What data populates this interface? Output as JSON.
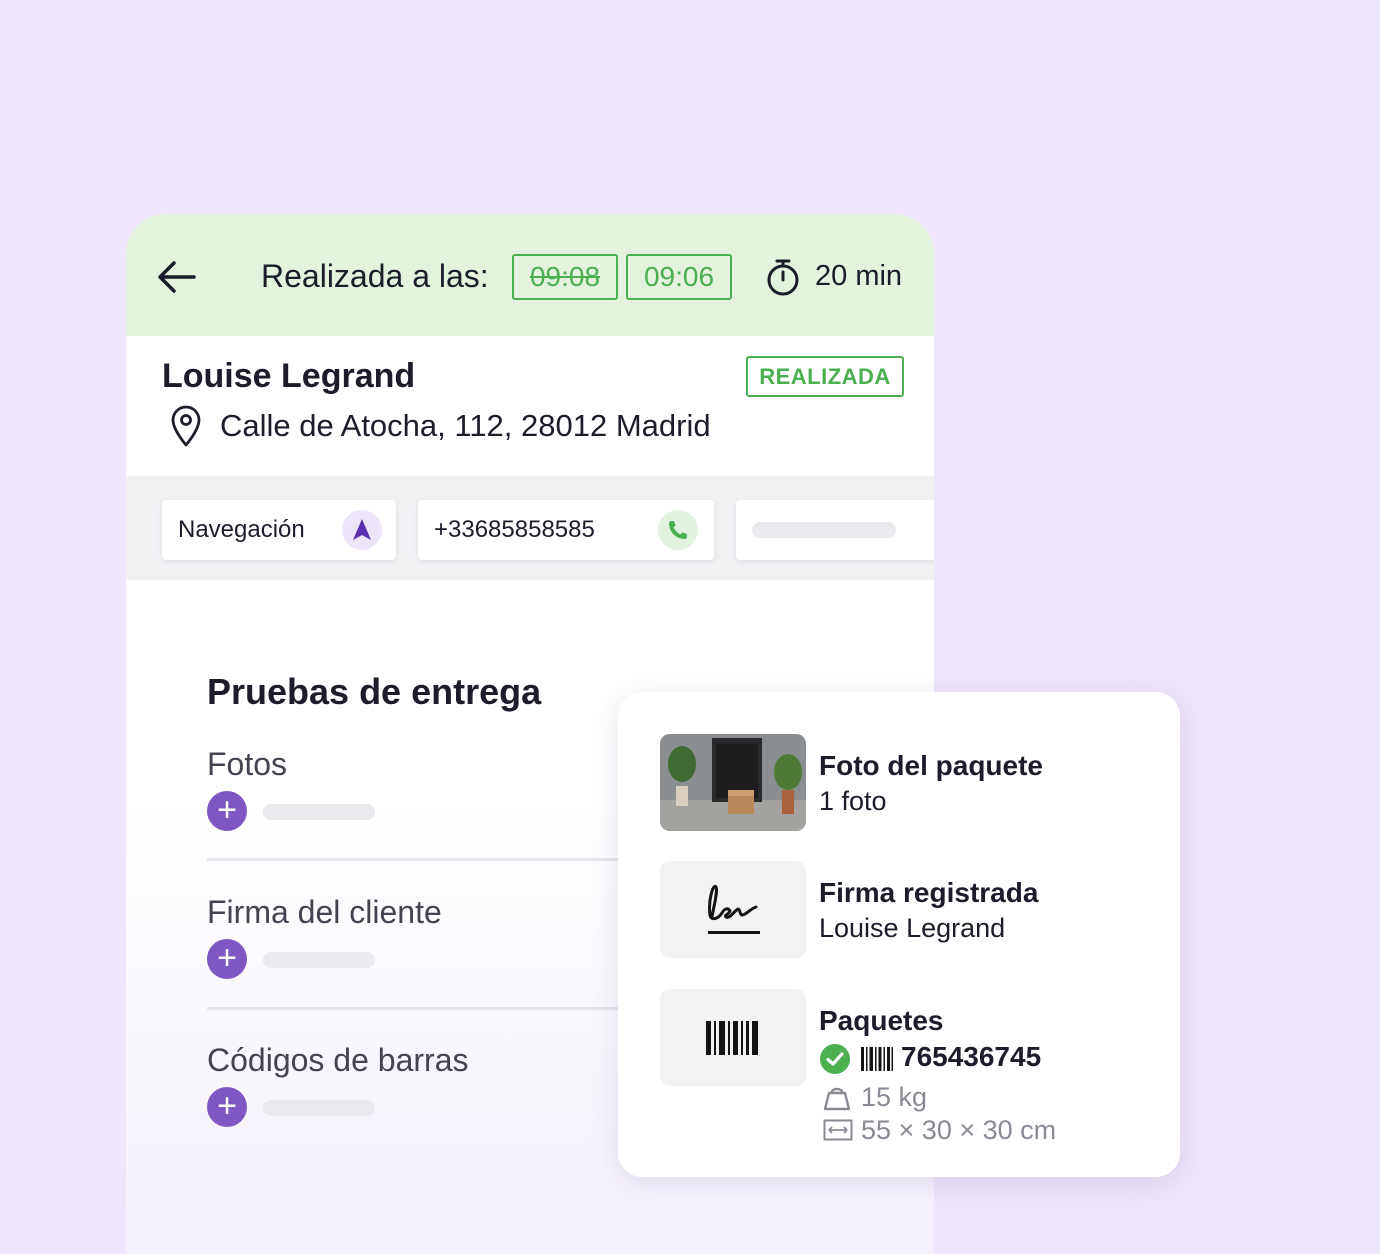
{
  "header": {
    "done_label": "Realizada a las:",
    "time_original": "09:08",
    "time_actual": "09:06",
    "duration": "20 min"
  },
  "customer": {
    "name": "Louise Legrand",
    "status": "REALIZADA",
    "address": "Calle de Atocha, 112, 28012 Madrid"
  },
  "actions": {
    "navigation_label": "Navegación",
    "phone": "+33685858585"
  },
  "proofs": {
    "title": "Pruebas de entrega",
    "items": [
      {
        "label": "Fotos"
      },
      {
        "label": "Firma del cliente"
      },
      {
        "label": "Códigos de barras"
      }
    ]
  },
  "summary": {
    "photo": {
      "title": "Foto del paquete",
      "subtitle": "1 foto"
    },
    "signature": {
      "title": "Firma registrada",
      "subtitle": "Louise Legrand"
    },
    "packages": {
      "title": "Paquetes",
      "barcode": "765436745",
      "weight": "15 kg",
      "dimensions": "55 × 30 × 30 cm"
    }
  },
  "colors": {
    "accent_green": "#4caf50",
    "accent_purple": "#7e57c2",
    "background": "#efe6fb",
    "header_bg": "#e3f3dd"
  },
  "icons": [
    "back-arrow-icon",
    "timer-icon",
    "location-pin-icon",
    "navigation-arrow-icon",
    "phone-icon",
    "plus-icon",
    "signature-icon",
    "barcode-icon",
    "check-circle-icon",
    "weight-icon",
    "dimensions-icon"
  ]
}
